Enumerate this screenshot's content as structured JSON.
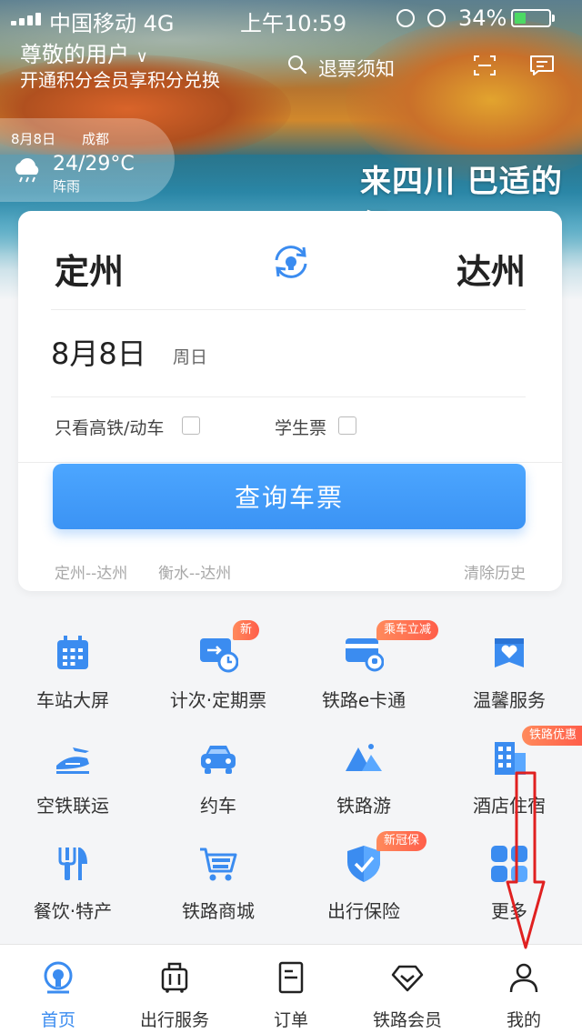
{
  "status_bar": {
    "carrier": "中国移动 4G",
    "time": "上午10:59",
    "battery_percent": "34%",
    "battery_level": 0.34
  },
  "header": {
    "user_name": "尊敬的用户",
    "user_sub": "开通积分会员享积分兑换",
    "search_text": "退票须知",
    "icons": [
      "search-icon",
      "scan-icon",
      "message-icon"
    ]
  },
  "weather": {
    "date": "8月8日",
    "city": "成都",
    "temp": "24/29°C",
    "condition": "阵雨"
  },
  "banner": {
    "slogan": "来四川 巴适的很"
  },
  "booking": {
    "from": "定州",
    "to": "达州",
    "date": "8月8日",
    "weekday": "周日",
    "option_highspeed": "只看高铁/动车",
    "option_student": "学生票",
    "query_button": "查询车票",
    "history": [
      "定州--达州",
      "衡水--达州"
    ],
    "clear_history": "清除历史"
  },
  "services": [
    {
      "label": "车站大屏",
      "icon": "calendar-icon"
    },
    {
      "label": "计次·定期票",
      "icon": "ticket-clock-icon",
      "tag": "新"
    },
    {
      "label": "铁路e卡通",
      "icon": "card-icon",
      "tag": "乘车立减"
    },
    {
      "label": "温馨服务",
      "icon": "heart-box-icon"
    },
    {
      "label": "空铁联运",
      "icon": "plane-train-icon"
    },
    {
      "label": "约车",
      "icon": "car-icon"
    },
    {
      "label": "铁路游",
      "icon": "mountain-icon"
    },
    {
      "label": "酒店住宿",
      "icon": "hotel-icon",
      "tag": "铁路优惠"
    },
    {
      "label": "餐饮·特产",
      "icon": "fork-knife-icon"
    },
    {
      "label": "铁路商城",
      "icon": "cart-icon"
    },
    {
      "label": "出行保险",
      "icon": "shield-icon",
      "tag": "新冠保"
    },
    {
      "label": "更多",
      "icon": "grid-icon"
    }
  ],
  "tabs": [
    {
      "label": "首页",
      "icon": "home-train-icon",
      "active": true
    },
    {
      "label": "出行服务",
      "icon": "luggage-icon"
    },
    {
      "label": "订单",
      "icon": "order-icon"
    },
    {
      "label": "铁路会员",
      "icon": "diamond-icon"
    },
    {
      "label": "我的",
      "icon": "person-icon"
    }
  ],
  "colors": {
    "accent": "#3b8cf0",
    "tag": "#ff6a4d",
    "annotation": "#e02020"
  }
}
